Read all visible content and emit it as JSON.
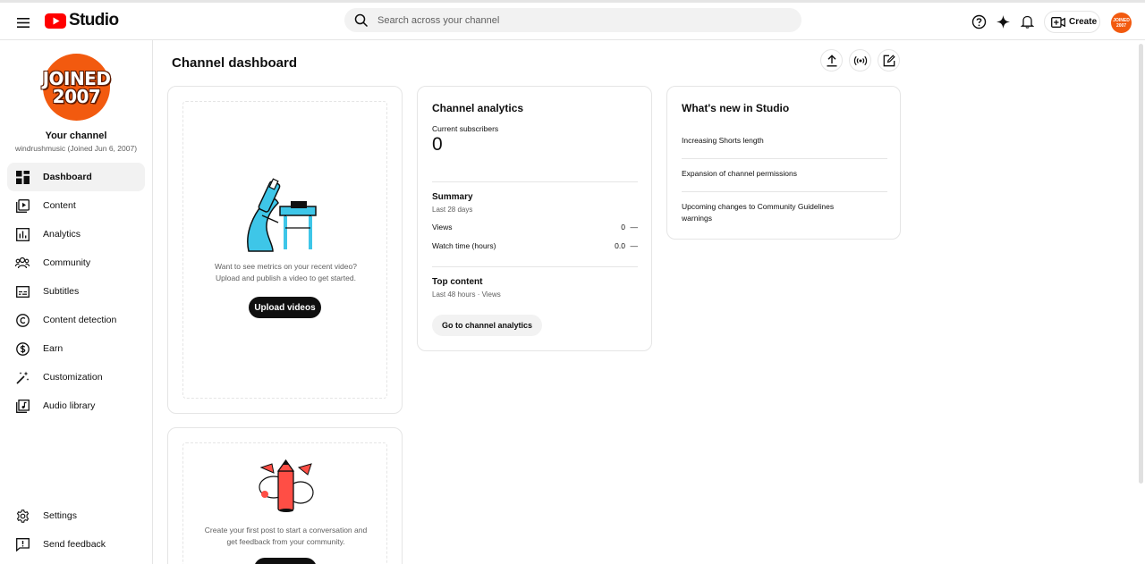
{
  "app": {
    "logo_text": "Studio",
    "brand_color": "#ff0000",
    "accent": "#f25a0f"
  },
  "search": {
    "placeholder": "Search across your channel"
  },
  "topbar": {
    "icons": [
      "menu-icon",
      "help-icon",
      "sparkle-icon",
      "notifications-icon"
    ],
    "create_label": "Create",
    "avatar_line1": "JOINED",
    "avatar_line2": "2007"
  },
  "sidebar": {
    "avatar_line1": "JOINED",
    "avatar_line2": "2007",
    "channel_title": "Your channel",
    "channel_meta": "windrushmusic (Joined Jun 6, 2007)",
    "items": [
      {
        "label": "Dashboard",
        "icon": "dashboard-icon",
        "active": true
      },
      {
        "label": "Content",
        "icon": "content-icon"
      },
      {
        "label": "Analytics",
        "icon": "analytics-icon"
      },
      {
        "label": "Community",
        "icon": "community-icon"
      },
      {
        "label": "Subtitles",
        "icon": "subtitles-icon"
      },
      {
        "label": "Content detection",
        "icon": "copyright-icon"
      },
      {
        "label": "Earn",
        "icon": "dollar-icon"
      },
      {
        "label": "Customization",
        "icon": "magic-wand-icon"
      },
      {
        "label": "Audio library",
        "icon": "audio-library-icon"
      }
    ],
    "bottom_items": [
      {
        "label": "Settings",
        "icon": "gear-icon"
      },
      {
        "label": "Send feedback",
        "icon": "feedback-icon"
      }
    ]
  },
  "main": {
    "title": "Channel dashboard",
    "header_icons": [
      "upload-icon",
      "go-live-icon",
      "create-post-icon"
    ],
    "upload_card": {
      "prompt_line1": "Want to see metrics on your recent video?",
      "prompt_line2": "Upload and publish a video to get started.",
      "button": "Upload videos"
    },
    "post_card": {
      "prompt_line1": "Create your first post to start a conversation and",
      "prompt_line2": "get feedback from your community."
    },
    "analytics": {
      "title": "Channel analytics",
      "subs_label": "Current subscribers",
      "subs_value": "0",
      "summary_title": "Summary",
      "summary_period": "Last 28 days",
      "rows": [
        {
          "label": "Views",
          "value": "0",
          "change": "—"
        },
        {
          "label": "Watch time (hours)",
          "value": "0.0",
          "change": "—"
        }
      ],
      "top_title": "Top content",
      "top_period": "Last 48 hours · Views",
      "button": "Go to channel analytics"
    },
    "whats_new": {
      "title": "What's new in Studio",
      "items": [
        "Increasing Shorts length",
        "Expansion of channel permissions",
        "Upcoming changes to Community Guidelines warnings"
      ]
    }
  }
}
